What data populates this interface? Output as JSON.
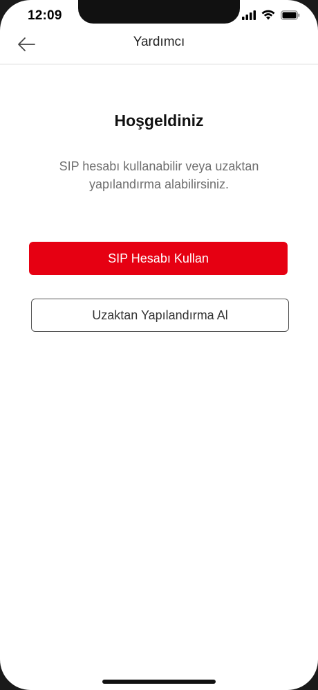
{
  "status_bar": {
    "time": "12:09",
    "icons": [
      "signal-icon",
      "wifi-icon",
      "battery-icon"
    ]
  },
  "header": {
    "back_icon": "arrow-left-icon",
    "title": "Yardımcı"
  },
  "welcome": {
    "title": "Hoşgeldiniz",
    "description": "SIP hesabı kullanabilir veya uzaktan yapılandırma alabilirsiniz."
  },
  "actions": {
    "primary_label": "SIP Hesabı Kullan",
    "secondary_label": "Uzaktan Yapılandırma Al"
  },
  "colors": {
    "accent": "#e60012",
    "text": "#111111",
    "muted_text": "#6f6f6f"
  }
}
